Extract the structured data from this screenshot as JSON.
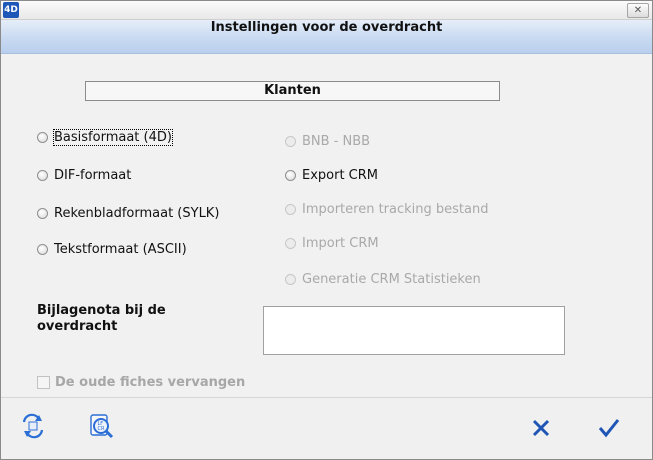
{
  "titlebar": {
    "app_icon_text": "4D",
    "close_glyph": "✕"
  },
  "header": {
    "title": "Instellingen voor de overdracht"
  },
  "section": {
    "title": "Klanten"
  },
  "formats": [
    {
      "label": "Basisformaat (4D)",
      "enabled": true
    },
    {
      "label": "DIF-formaat",
      "enabled": true
    },
    {
      "label": "Rekenbladformaat (SYLK)",
      "enabled": true
    },
    {
      "label": "Tekstformaat (ASCII)",
      "enabled": true
    }
  ],
  "options": [
    {
      "label": "BNB - NBB",
      "enabled": false
    },
    {
      "label": "Export CRM",
      "enabled": true
    },
    {
      "label": "Importeren tracking bestand",
      "enabled": false
    },
    {
      "label": "Import CRM",
      "enabled": false
    },
    {
      "label": "Generatie CRM Statistieken",
      "enabled": false
    }
  ],
  "notes": {
    "label": "Bijlagenota bij de overdracht",
    "value": ""
  },
  "replace_checkbox": {
    "label": "De oude fiches vervangen",
    "checked": false,
    "enabled": false
  },
  "toolbar": {
    "left_icons": [
      "convert-icon",
      "lf-cr-search-icon"
    ],
    "cancel_icon": "x-icon",
    "ok_icon": "checkmark-icon"
  },
  "colors": {
    "accent_blue": "#1f56b5",
    "header_gradient_top": "#e6eef9",
    "header_gradient_bottom": "#b9cfee"
  }
}
